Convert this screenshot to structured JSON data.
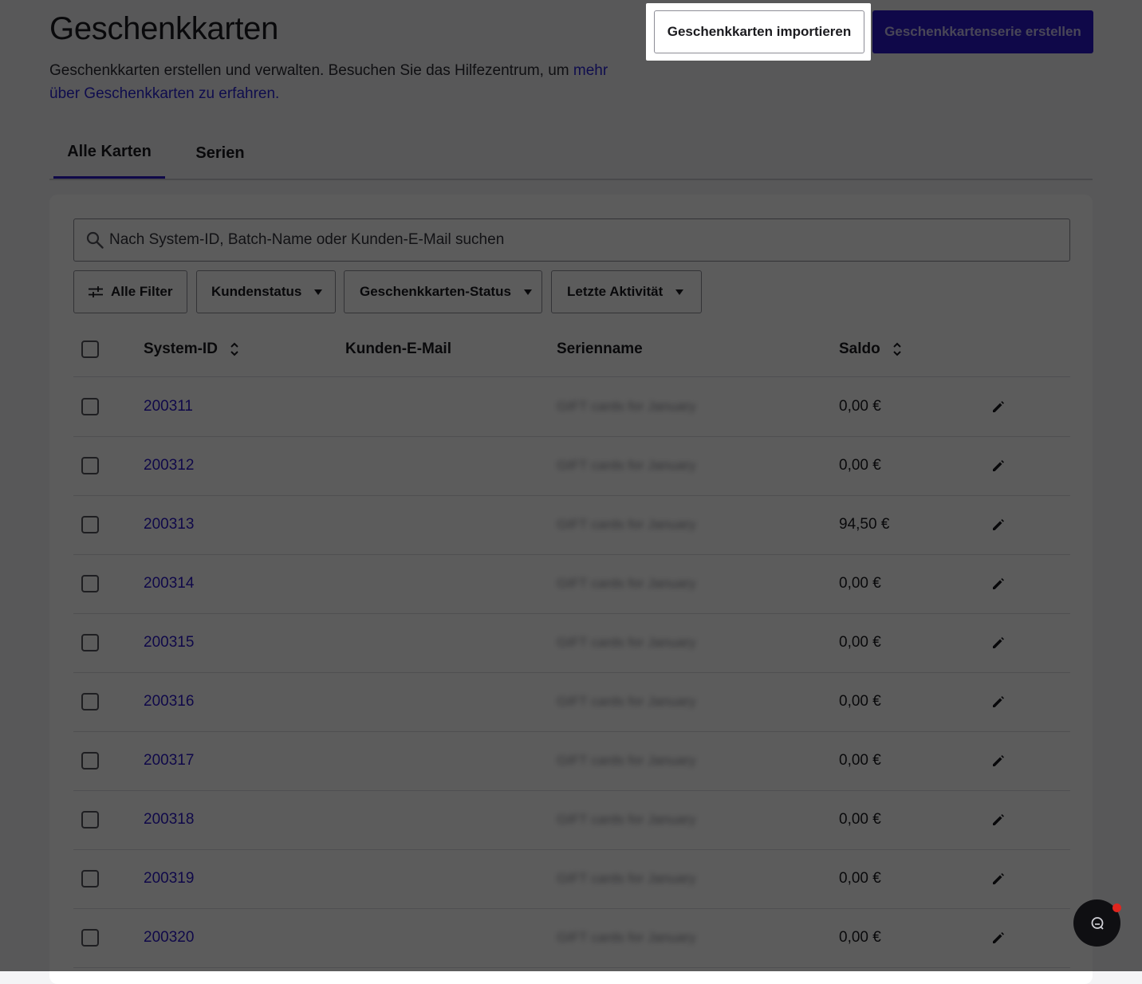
{
  "page": {
    "title": "Geschenkkarten",
    "subtitle_text": "Geschenkkarten erstellen und verwalten. Besuchen Sie das Hilfezentrum, um ",
    "subtitle_link": "mehr über Geschenkkarten zu erfahren."
  },
  "actions": {
    "import_label": "Geschenkkarten importieren",
    "create_series_label": "Geschenkkartenserie erstellen"
  },
  "tabs": [
    {
      "label": "Alle Karten",
      "active": true
    },
    {
      "label": "Serien",
      "active": false
    }
  ],
  "search": {
    "placeholder": "Nach System-ID, Batch-Name oder Kunden-E-Mail suchen",
    "value": ""
  },
  "filters": {
    "all_filters": "Alle Filter",
    "customer_status": "Kundenstatus",
    "giftcard_status": "Geschenkkarten-Status",
    "last_activity": "Letzte Aktivität"
  },
  "table": {
    "columns": {
      "system_id": "System-ID",
      "customer_email": "Kunden-E-Mail",
      "series_name": "Serienname",
      "balance": "Saldo"
    },
    "rows": [
      {
        "system_id": "200311",
        "customer_email": "",
        "series_name": "GIFT cards for January",
        "balance": "0,00 €"
      },
      {
        "system_id": "200312",
        "customer_email": "",
        "series_name": "GIFT cards for January",
        "balance": "0,00 €"
      },
      {
        "system_id": "200313",
        "customer_email": "",
        "series_name": "GIFT cards for January",
        "balance": "94,50 €"
      },
      {
        "system_id": "200314",
        "customer_email": "",
        "series_name": "GIFT cards for January",
        "balance": "0,00 €"
      },
      {
        "system_id": "200315",
        "customer_email": "",
        "series_name": "GIFT cards for January",
        "balance": "0,00 €"
      },
      {
        "system_id": "200316",
        "customer_email": "",
        "series_name": "GIFT cards for January",
        "balance": "0,00 €"
      },
      {
        "system_id": "200317",
        "customer_email": "",
        "series_name": "GIFT cards for January",
        "balance": "0,00 €"
      },
      {
        "system_id": "200318",
        "customer_email": "",
        "series_name": "GIFT cards for January",
        "balance": "0,00 €"
      },
      {
        "system_id": "200319",
        "customer_email": "",
        "series_name": "GIFT cards for January",
        "balance": "0,00 €"
      },
      {
        "system_id": "200320",
        "customer_email": "",
        "series_name": "GIFT cards for January",
        "balance": "0,00 €"
      }
    ]
  },
  "icons": {
    "search": "search-icon",
    "filter": "sliders-icon",
    "sort": "sort-icon",
    "edit": "pencil-icon",
    "chat": "chat-icon",
    "dropdown": "caret-down-icon"
  },
  "colors": {
    "accent": "#2a18c9",
    "link": "#2c24d6",
    "overlay": "rgba(0,0,0,0.64)",
    "notification": "#e0261f"
  }
}
